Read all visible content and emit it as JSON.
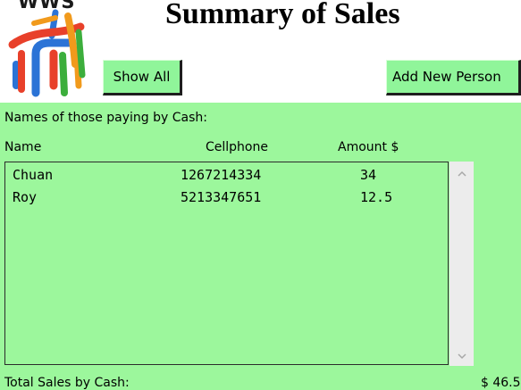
{
  "header": {
    "logo_text": "WWS",
    "title": "Summary of Sales"
  },
  "toolbar": {
    "show_all_label": "Show All",
    "add_person_label": "Add New Person"
  },
  "cash_section": {
    "label": "Names of those paying by Cash:",
    "columns": {
      "name": "Name",
      "cellphone": "Cellphone",
      "amount": "Amount $"
    },
    "rows": [
      {
        "name": "Chuan",
        "cellphone": "1267214334",
        "amount": "34"
      },
      {
        "name": "Roy",
        "cellphone": "5213347651",
        "amount": "12.5"
      }
    ],
    "total_label": "Total Sales by Cash:",
    "total_value": "$ 46.5"
  },
  "scrollbar": {
    "up_icon": "chevron-up-icon",
    "down_icon": "chevron-down-icon"
  },
  "colors": {
    "panel": "#9cf79c",
    "button": "#90f59a",
    "logo_blue": "#2b73d6",
    "logo_red": "#e8402a",
    "logo_orange": "#f19a1c",
    "logo_green": "#3cae3c"
  }
}
